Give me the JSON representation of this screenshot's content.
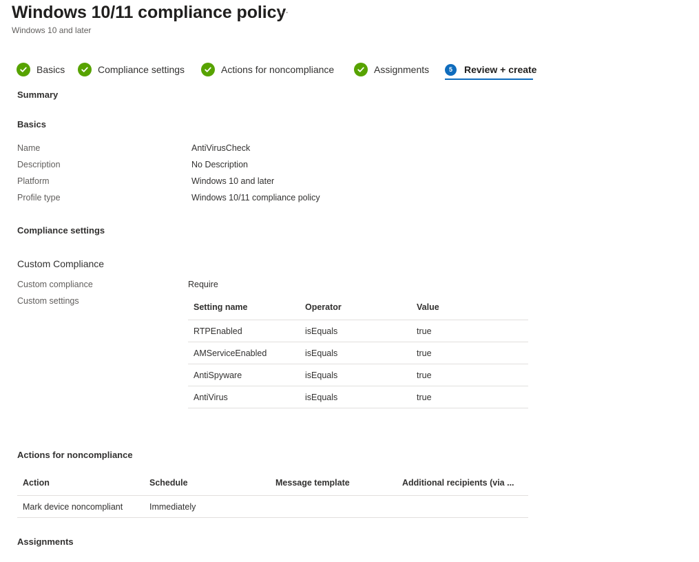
{
  "header": {
    "title": "Windows 10/11 compliance policy",
    "more_label": "···",
    "subtitle": "Windows 10 and later"
  },
  "wizard": {
    "steps": [
      {
        "label": "Basics",
        "state": "complete"
      },
      {
        "label": "Compliance settings",
        "state": "complete"
      },
      {
        "label": "Actions for noncompliance",
        "state": "complete"
      },
      {
        "label": "Assignments",
        "state": "complete"
      },
      {
        "label": "Review + create",
        "state": "active",
        "number": "5"
      }
    ]
  },
  "summary": {
    "heading": "Summary",
    "basics": {
      "heading": "Basics",
      "rows": [
        {
          "label": "Name",
          "value": "AntiVirusCheck"
        },
        {
          "label": "Description",
          "value": "No Description"
        },
        {
          "label": "Platform",
          "value": "Windows 10 and later"
        },
        {
          "label": "Profile type",
          "value": "Windows 10/11 compliance policy"
        }
      ]
    },
    "compliance": {
      "heading": "Compliance settings",
      "subheading": "Custom Compliance",
      "custom_compliance_label": "Custom compliance",
      "custom_compliance_value": "Require",
      "custom_settings_label": "Custom settings",
      "table": {
        "columns": [
          "Setting name",
          "Operator",
          "Value"
        ],
        "rows": [
          [
            "RTPEnabled",
            "isEquals",
            "true"
          ],
          [
            "AMServiceEnabled",
            "isEquals",
            "true"
          ],
          [
            "AntiSpyware",
            "isEquals",
            "true"
          ],
          [
            "AntiVirus",
            "isEquals",
            "true"
          ]
        ]
      }
    },
    "actions": {
      "heading": "Actions for noncompliance",
      "table": {
        "columns": [
          "Action",
          "Schedule",
          "Message template",
          "Additional recipients (via ..."
        ],
        "rows": [
          [
            "Mark device noncompliant",
            "Immediately",
            "",
            ""
          ]
        ]
      }
    },
    "assignments": {
      "heading": "Assignments"
    }
  },
  "colors": {
    "complete_check": "#57a300",
    "active_step": "#0f6cbd"
  }
}
